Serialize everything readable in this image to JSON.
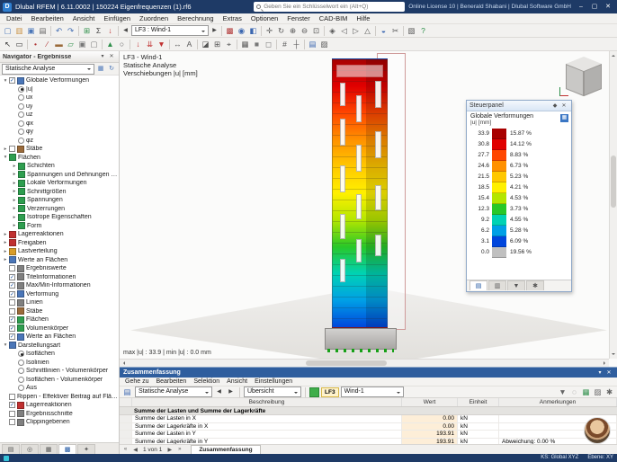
{
  "ui": {
    "check": "✓"
  },
  "titlebar": {
    "logo_text": "D",
    "app_title": "Dlubal RFEM | 6.11.0002 | 150224 Eigenfrequenzen (1).rf6",
    "search_placeholder": "Geben Sie ein Schlüsselwort ein (Alt+Q)",
    "license_text": "Online License 10 | Benerald Shabani | Dlubal Software GmbH",
    "controls": [
      {
        "n": "minimize-button",
        "g": "–"
      },
      {
        "n": "maximize-button",
        "g": "▢"
      },
      {
        "n": "close-button",
        "g": "✕"
      }
    ]
  },
  "menubar": {
    "items": [
      "Datei",
      "Bearbeiten",
      "Ansicht",
      "Einfügen",
      "Zuordnen",
      "Berechnung",
      "Extras",
      "Optionen",
      "Fenster",
      "CAD-BIM",
      "Hilfe"
    ]
  },
  "toolbar1": {
    "loadcase_selector": "LF3 : Wind-1",
    "prev_glyph": "◀",
    "next_glyph": "▶",
    "icons_a": [
      {
        "n": "new-model-icon",
        "g": "▢",
        "c": "#4a76b8"
      },
      {
        "n": "open-model-icon",
        "g": "▥",
        "c": "#c89040"
      },
      {
        "n": "save-icon",
        "g": "▣",
        "c": "#4a76b8"
      },
      {
        "n": "print-icon",
        "g": "▤",
        "c": "#666666"
      },
      {
        "sep": true
      },
      {
        "n": "undo-icon",
        "g": "↶",
        "c": "#3a66b0"
      },
      {
        "n": "redo-icon",
        "g": "↷",
        "c": "#3a66b0"
      },
      {
        "sep": true
      },
      {
        "n": "calculate-all-icon",
        "g": "⊞",
        "c": "#2e8f4a"
      },
      {
        "n": "calculation-sum-icon",
        "g": "Σ",
        "c": "#444444"
      },
      {
        "n": "load-arrow-icon",
        "g": "↓",
        "c": "#c03030"
      },
      {
        "sep": true
      }
    ],
    "icons_b": [
      {
        "sep": true
      },
      {
        "n": "show-results-icon",
        "g": "▩",
        "c": "#b03535"
      },
      {
        "n": "result-values-icon",
        "g": "◉",
        "c": "#3a66b0"
      },
      {
        "n": "control-panel-icon",
        "g": "◧",
        "c": "#3a66b0"
      },
      {
        "sep": true
      },
      {
        "n": "pan-icon",
        "g": "✛",
        "c": "#555555"
      },
      {
        "n": "rotate-view-icon",
        "g": "↻",
        "c": "#555555"
      },
      {
        "n": "zoom-in-icon",
        "g": "⊕",
        "c": "#555555"
      },
      {
        "n": "zoom-out-icon",
        "g": "⊖",
        "c": "#555555"
      },
      {
        "n": "zoom-window-icon",
        "g": "⊡",
        "c": "#555555"
      },
      {
        "sep": true
      },
      {
        "n": "isometric-view-icon",
        "g": "◈",
        "c": "#555555"
      },
      {
        "n": "view-x-icon",
        "g": "◁",
        "c": "#555555"
      },
      {
        "n": "view-y-icon",
        "g": "▷",
        "c": "#555555"
      },
      {
        "n": "view-z-icon",
        "g": "△",
        "c": "#555555"
      },
      {
        "sep": true
      },
      {
        "n": "visibility-icon",
        "g": "◒",
        "c": "#3a66b0"
      },
      {
        "n": "clipping-icon",
        "g": "✂",
        "c": "#555555"
      },
      {
        "sep": true
      },
      {
        "n": "screenshot-icon",
        "g": "▧",
        "c": "#555555"
      },
      {
        "n": "help-icon",
        "g": "?",
        "c": "#2e8f4a"
      }
    ]
  },
  "toolbar2": {
    "icons": [
      {
        "n": "select-cursor-icon",
        "g": "↖",
        "c": "#333333"
      },
      {
        "n": "select-box-icon",
        "g": "▭",
        "c": "#333333"
      },
      {
        "sep": true
      },
      {
        "n": "node-icon",
        "g": "•",
        "c": "#b03535"
      },
      {
        "n": "line-icon",
        "g": "∕",
        "c": "#b03535"
      },
      {
        "n": "member-icon",
        "g": "▬",
        "c": "#9a6a3a"
      },
      {
        "n": "surface-icon",
        "g": "▱",
        "c": "#2e8f4a"
      },
      {
        "n": "solid-icon",
        "g": "▣",
        "c": "#777777"
      },
      {
        "n": "opening-icon",
        "g": "▢",
        "c": "#777777"
      },
      {
        "sep": true
      },
      {
        "n": "support-icon",
        "g": "▲",
        "c": "#2e8f4a"
      },
      {
        "n": "hinge-icon",
        "g": "○",
        "c": "#555555"
      },
      {
        "sep": true
      },
      {
        "n": "nodal-load-icon",
        "g": "↓",
        "c": "#c03030"
      },
      {
        "n": "line-load-icon",
        "g": "⇊",
        "c": "#c03030"
      },
      {
        "n": "surface-load-icon",
        "g": "▼",
        "c": "#c03030"
      },
      {
        "sep": true
      },
      {
        "n": "dimension-icon",
        "g": "↔",
        "c": "#555555"
      },
      {
        "n": "text-annotation-icon",
        "g": "A",
        "c": "#555555"
      },
      {
        "sep": true
      },
      {
        "n": "section-plane-icon",
        "g": "◪",
        "c": "#555555"
      },
      {
        "n": "grid-icon",
        "g": "⊞",
        "c": "#555555"
      },
      {
        "n": "snap-icon",
        "g": "⌖",
        "c": "#555555"
      },
      {
        "sep": true
      },
      {
        "n": "wireframe-icon",
        "g": "▦",
        "c": "#555555"
      },
      {
        "n": "solid-render-icon",
        "g": "■",
        "c": "#777777"
      },
      {
        "n": "transparency-icon",
        "g": "◻",
        "c": "#777777"
      },
      {
        "sep": true
      },
      {
        "n": "numbering-icon",
        "g": "#",
        "c": "#555555"
      },
      {
        "n": "axes-icon",
        "g": "┼",
        "c": "#555555"
      },
      {
        "sep": true
      },
      {
        "n": "tables-icon",
        "g": "▤",
        "c": "#3a66b0"
      },
      {
        "n": "report-icon",
        "g": "▨",
        "c": "#555555"
      }
    ]
  },
  "navigator": {
    "title": "Navigator - Ergebnisse",
    "header_controls": [
      {
        "n": "navigator-pin-icon",
        "g": "▾"
      },
      {
        "n": "navigator-close-icon",
        "g": "✕"
      }
    ],
    "analysis_dropdown": "Statische Analyse",
    "combo_buttons": [
      {
        "n": "analysis-settings-icon",
        "g": "▦",
        "c": "#4a76b8"
      },
      {
        "n": "analysis-refresh-icon",
        "g": "↻",
        "c": "#4a76b8"
      }
    ],
    "tree": [
      {
        "l": 0,
        "exp": "▾",
        "ctl": "check",
        "on": true,
        "icon": "#4a76b8",
        "label": "Globale Verformungen"
      },
      {
        "l": 1,
        "ctl": "radio",
        "on": true,
        "label": "|u|"
      },
      {
        "l": 1,
        "ctl": "radio",
        "label": "ux"
      },
      {
        "l": 1,
        "ctl": "radio",
        "label": "uy"
      },
      {
        "l": 1,
        "ctl": "radio",
        "label": "uz"
      },
      {
        "l": 1,
        "ctl": "radio",
        "label": "φx"
      },
      {
        "l": 1,
        "ctl": "radio",
        "label": "φy"
      },
      {
        "l": 1,
        "ctl": "radio",
        "label": "φz"
      },
      {
        "l": 0,
        "exp": "▸",
        "ctl": "check",
        "icon": "#9a6a3a",
        "label": "Stäbe"
      },
      {
        "l": 0,
        "exp": "▾",
        "icon": "#2e9e4f",
        "label": "Flächen"
      },
      {
        "l": 1,
        "exp": "▸",
        "icon": "#2e9e4f",
        "label": "Schichten"
      },
      {
        "l": 1,
        "exp": "▸",
        "icon": "#2e9e4f",
        "label": "Spannungen und Dehnungen nach SchichtMdl."
      },
      {
        "l": 1,
        "exp": "▸",
        "icon": "#2e9e4f",
        "label": "Lokale Verformungen"
      },
      {
        "l": 1,
        "exp": "▸",
        "icon": "#2e9e4f",
        "label": "Schnittgrößen"
      },
      {
        "l": 1,
        "exp": "▸",
        "icon": "#2e9e4f",
        "label": "Spannungen"
      },
      {
        "l": 1,
        "exp": "▸",
        "icon": "#2e9e4f",
        "label": "Verzerrungen"
      },
      {
        "l": 1,
        "exp": "▸",
        "icon": "#2e9e4f",
        "label": "Isotrope Eigenschaften"
      },
      {
        "l": 1,
        "exp": "▸",
        "icon": "#2e9e4f",
        "label": "Form"
      },
      {
        "l": 0,
        "exp": "▸",
        "icon": "#c03030",
        "label": "Lagerreaktionen"
      },
      {
        "l": 0,
        "exp": "▸",
        "icon": "#c03030",
        "label": "Freigaben"
      },
      {
        "l": 0,
        "exp": "▸",
        "icon": "#d89c28",
        "label": "Lastverteilung"
      },
      {
        "l": 0,
        "exp": "▸",
        "icon": "#4a76b8",
        "label": "Werte an Flächen"
      },
      {
        "l": 0,
        "ctl": "check",
        "icon": "#808080",
        "label": "Ergebniswerte"
      },
      {
        "l": 0,
        "ctl": "check",
        "on": true,
        "icon": "#808080",
        "label": "Titelinformationen"
      },
      {
        "l": 0,
        "ctl": "check",
        "on": true,
        "icon": "#808080",
        "label": "Max/Min-Informationen"
      },
      {
        "l": 0,
        "ctl": "check",
        "on": true,
        "icon": "#4a76b8",
        "label": "Verformung"
      },
      {
        "l": 0,
        "ctl": "check",
        "icon": "#808080",
        "label": "Linien"
      },
      {
        "l": 0,
        "ctl": "check",
        "icon": "#9a6a3a",
        "label": "Stäbe"
      },
      {
        "l": 0,
        "ctl": "check",
        "on": true,
        "icon": "#2e9e4f",
        "label": "Flächen"
      },
      {
        "l": 0,
        "ctl": "check",
        "on": true,
        "icon": "#2e9e4f",
        "label": "Volumenkörper"
      },
      {
        "l": 0,
        "ctl": "check",
        "on": true,
        "icon": "#4a76b8",
        "label": "Werte an Flächen"
      },
      {
        "l": 0,
        "exp": "▾",
        "icon": "#4a76b8",
        "label": "Darstellungsart"
      },
      {
        "l": 1,
        "ctl": "radio",
        "on": true,
        "label": "Isoflächen"
      },
      {
        "l": 1,
        "ctl": "radio",
        "label": "Isolinien"
      },
      {
        "l": 1,
        "ctl": "radio",
        "label": "Schnittlinien - Volumenkörper"
      },
      {
        "l": 1,
        "ctl": "radio",
        "label": "Isoflächen - Volumenkörper"
      },
      {
        "l": 1,
        "ctl": "radio",
        "label": "Aus"
      },
      {
        "l": 0,
        "ctl": "check",
        "label": "Rippen - Effektiver Beitrag auf Fläche/Stab"
      },
      {
        "l": 0,
        "ctl": "check",
        "on": true,
        "icon": "#c03030",
        "label": "Lagerreaktionen"
      },
      {
        "l": 0,
        "ctl": "check",
        "icon": "#808080",
        "label": "Ergebnisschnitte"
      },
      {
        "l": 0,
        "ctl": "check",
        "icon": "#808080",
        "label": "Clippingebenen"
      }
    ],
    "tabs": [
      {
        "n": "navigator-tab-daten-icon",
        "g": "▤"
      },
      {
        "n": "navigator-tab-zeigen-icon",
        "g": "◎"
      },
      {
        "n": "navigator-tab-ansichten-icon",
        "g": "▦"
      },
      {
        "n": "navigator-tab-ergebnisse-icon",
        "g": "▩",
        "active": true
      },
      {
        "n": "navigator-tab-anzeige-icon",
        "g": "✦"
      }
    ]
  },
  "viewport": {
    "header_lines": [
      "LF3 - Wind-1",
      "Statische Analyse",
      "Verschiebungen |u| [mm]"
    ],
    "maxmin": "max |u| : 33.9 | min |u| : 0.0 mm"
  },
  "panel": {
    "title": "Steuerpanel",
    "controls": [
      {
        "n": "panel-pin-icon",
        "g": "◆"
      },
      {
        "n": "panel-close-icon",
        "g": "✕"
      }
    ],
    "subtitle": "Globale Verformungen",
    "unit": "|u| [mm]",
    "gear_glyph": "▦",
    "scale": [
      {
        "value": "33.9",
        "pct": "15.87 %",
        "color": "#a80000"
      },
      {
        "value": "30.8",
        "pct": "14.12 %",
        "color": "#e00000"
      },
      {
        "value": "27.7",
        "pct": "8.83 %",
        "color": "#ff4600"
      },
      {
        "value": "24.6",
        "pct": "6.73 %",
        "color": "#ff9100"
      },
      {
        "value": "21.5",
        "pct": "5.23 %",
        "color": "#ffc800"
      },
      {
        "value": "18.5",
        "pct": "4.21 %",
        "color": "#fff000"
      },
      {
        "value": "15.4",
        "pct": "4.53 %",
        "color": "#b4e600"
      },
      {
        "value": "12.3",
        "pct": "3.73 %",
        "color": "#28c828"
      },
      {
        "value": "9.2",
        "pct": "4.55 %",
        "color": "#00d2b4"
      },
      {
        "value": "6.2",
        "pct": "5.28 %",
        "color": "#00a0e6"
      },
      {
        "value": "3.1",
        "pct": "6.09 %",
        "color": "#0046dc"
      },
      {
        "value": "0.0",
        "pct": "19.56 %",
        "color": "#c0c0c0",
        "gray": true
      }
    ],
    "tabs": [
      {
        "n": "panel-tab-farbskala-icon",
        "g": "▤",
        "active": true
      },
      {
        "n": "panel-tab-faktoren-icon",
        "g": "▥"
      },
      {
        "n": "panel-tab-filter-icon",
        "g": "▼"
      },
      {
        "n": "panel-tab-einstellungen-icon",
        "g": "✱"
      }
    ]
  },
  "summary": {
    "title": "Zusammenfassung",
    "title_controls": [
      {
        "n": "summary-dock-icon",
        "g": "▾"
      },
      {
        "n": "summary-close-icon",
        "g": "✕"
      }
    ],
    "menu_items": [
      "Gehe zu",
      "Bearbeiten",
      "Selektion",
      "Ansicht",
      "Einstellungen"
    ],
    "toolbar": {
      "table_icon_glyph": "▤",
      "analysis": "Statische Analyse",
      "prev_glyph": "◀",
      "next_glyph": "▶",
      "view": "Übersicht",
      "loadcase_short": "LF3",
      "loadcase_name": "Wind-1",
      "right_icons": [
        {
          "n": "table-filter-icon",
          "g": "▼",
          "c": "#666666"
        },
        {
          "n": "table-search-icon",
          "g": "◌",
          "c": "#666666"
        },
        {
          "n": "table-export-excel-icon",
          "g": "▦",
          "c": "#2e8f4a"
        },
        {
          "n": "table-print-icon",
          "g": "▨",
          "c": "#666666"
        },
        {
          "n": "table-settings-icon",
          "g": "✱",
          "c": "#666666"
        }
      ]
    },
    "columns": [
      "Beschreibung",
      "Wert",
      "Einheit",
      "Anmerkungen"
    ],
    "section_header": "Summe der Lasten und Summe der Lagerkräfte",
    "rows": [
      {
        "beschreibung": "Summe der Lasten in X",
        "wert": "0.00",
        "einheit": "kN",
        "anmerkung": ""
      },
      {
        "beschreibung": "Summe der Lagerkräfte in X",
        "wert": "0.00",
        "einheit": "kN",
        "anmerkung": ""
      },
      {
        "beschreibung": "Summe der Lasten in Y",
        "wert": "193.91",
        "einheit": "kN",
        "anmerkung": ""
      },
      {
        "beschreibung": "Summe der Lagerkräfte in Y",
        "wert": "193.91",
        "einheit": "kN",
        "anmerkung": "Abweichung: 0.00 %"
      }
    ],
    "pager": {
      "first_glyph": "«",
      "prev_glyph": "◀",
      "label": "1 von 1",
      "next_glyph": "▶",
      "last_glyph": "»"
    },
    "tab_label": "Zusammenfassung"
  },
  "statusbar": {
    "right_items": [
      "KS: Global XYZ",
      "Ebene: XY"
    ]
  }
}
